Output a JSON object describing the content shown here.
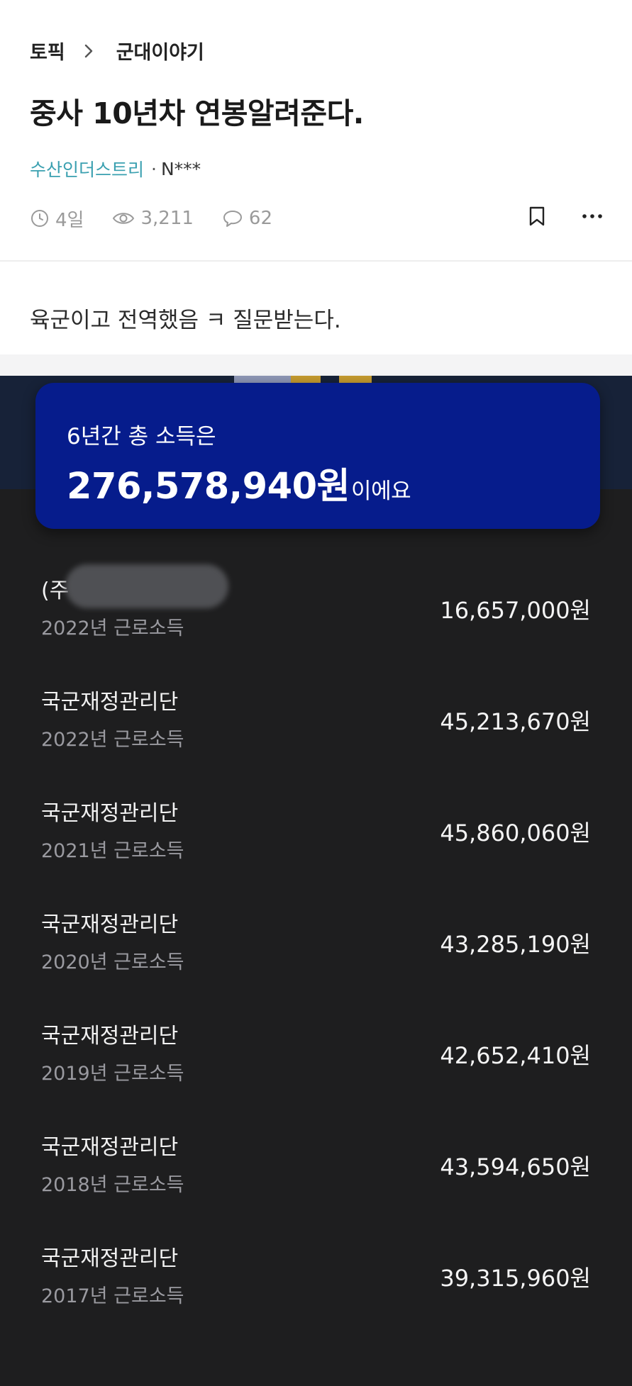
{
  "breadcrumb": {
    "root": "토픽",
    "current": "군대이야기"
  },
  "post": {
    "title": "중사 10년차 연봉알려준다.",
    "company": "수산인더스트리",
    "separator": "·",
    "author": "N***",
    "time": "4일",
    "views": "3,211",
    "comments": "62",
    "body": "육군이고 전역했음 ㅋ 질문받는다."
  },
  "icons": {
    "breadcrumb_separator": "chevron-right-icon",
    "time": "clock-icon",
    "views": "eye-icon",
    "comments": "comment-icon",
    "bookmark": "bookmark-icon",
    "more": "more-icon"
  },
  "summary": {
    "label": "6년간 총 소득은",
    "amount": "276,578,940원",
    "suffix": "이에요"
  },
  "income_rows": [
    {
      "employer": "(주",
      "year": "2022년 근로소득",
      "amount": "16,657,000원",
      "redacted": true
    },
    {
      "employer": "국군재정관리단",
      "year": "2022년 근로소득",
      "amount": "45,213,670원"
    },
    {
      "employer": "국군재정관리단",
      "year": "2021년 근로소득",
      "amount": "45,860,060원"
    },
    {
      "employer": "국군재정관리단",
      "year": "2020년 근로소득",
      "amount": "43,285,190원"
    },
    {
      "employer": "국군재정관리단",
      "year": "2019년 근로소득",
      "amount": "42,652,410원"
    },
    {
      "employer": "국군재정관리단",
      "year": "2018년 근로소득",
      "amount": "43,594,650원"
    },
    {
      "employer": "국군재정관리단",
      "year": "2017년 근로소득",
      "amount": "39,315,960원"
    }
  ],
  "colors": {
    "company_accent": "#3aa0b0",
    "card_blue": "#061c8c",
    "dark_bg": "#1e1e1f"
  }
}
